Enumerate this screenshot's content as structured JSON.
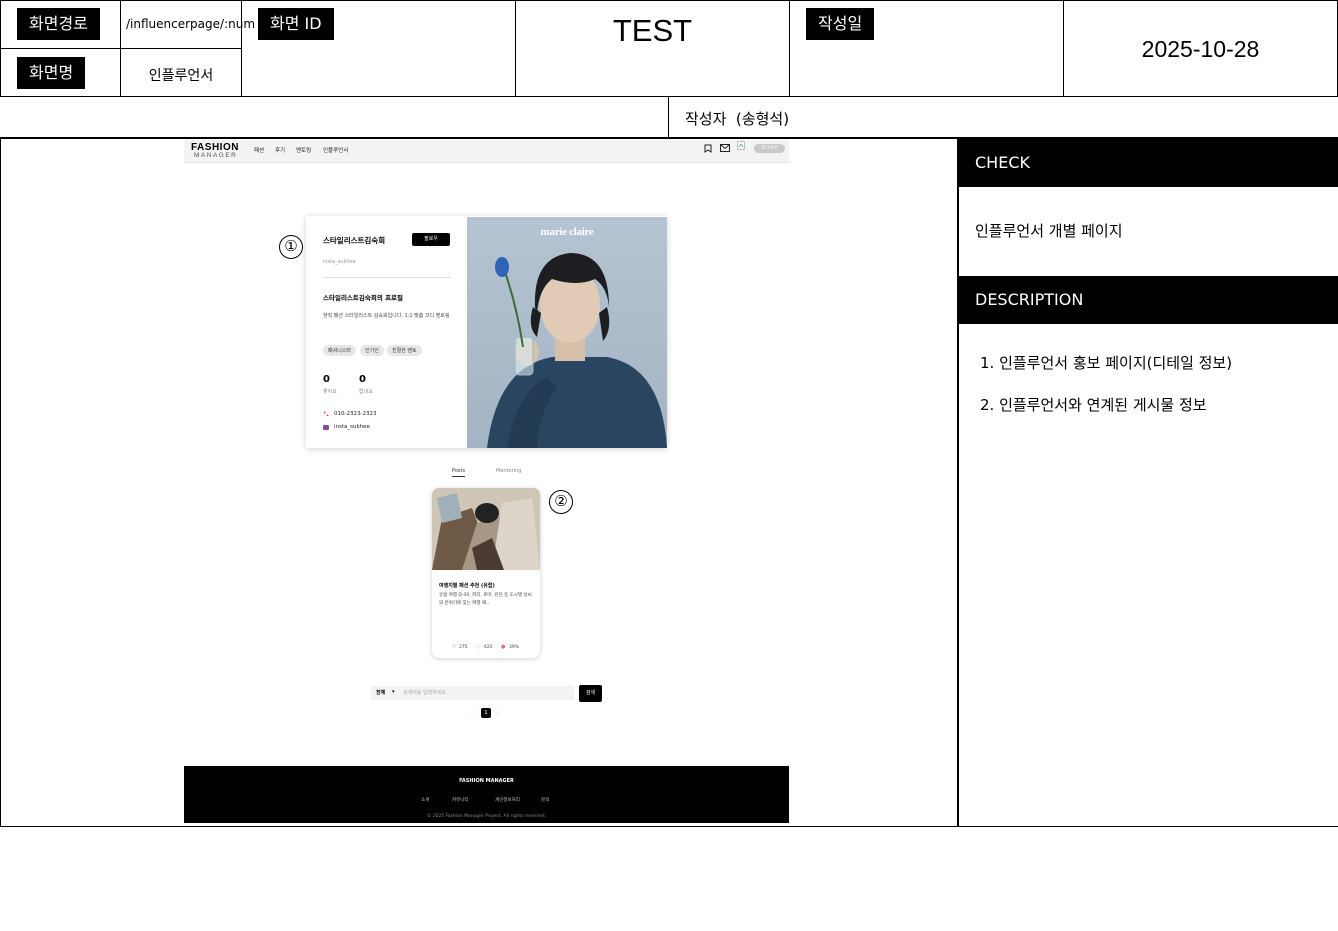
{
  "header": {
    "path_label": "화면경로",
    "path_value": "/influencerpage/:num",
    "name_label": "화면명",
    "name_value": "인플루언서",
    "id_label": "화면 ID",
    "test_value": "TEST",
    "date_label": "작성일",
    "date_value": "2025-10-28",
    "author": "작성자  (송형석)"
  },
  "site": {
    "logo_top": "FASHION",
    "logo_bottom": "MANAGER",
    "nav_items": [
      "패션",
      "후기",
      "멘토링",
      "인플루언서"
    ],
    "logout_label": "로그아웃",
    "profile": {
      "name": "스타일리스트김숙희",
      "follow_label": "팔로우",
      "handle": "insta_sukhee",
      "profile_title": "스타일리스트김숙희의 프로필",
      "description": "현직 패션 스타일리스트 김숙희입니다. 1:1 맞춤 코디 멘토링",
      "tags": [
        "패셔니스타",
        "인기인",
        "친절한 멘토"
      ],
      "likes_count": "0",
      "likes_label": "좋아요",
      "reviews_count": "0",
      "reviews_label": "랍내요",
      "phone": "010-2323-2323",
      "instagram": "insta_sukhee",
      "photo_brand": "marie claire"
    },
    "tabs": [
      "Posts",
      "Mentoring"
    ],
    "post": {
      "title": "여행지별 패션 추천 (유럽)",
      "excerpt": "유럽 여행 D-30, 파리, 로마, 런던 등 도시별 날씨와 분위기에 맞는 여행 패...",
      "likes": "275",
      "views": "425",
      "rate": "39%"
    },
    "search": {
      "select_value": "전체",
      "placeholder": "검색어를 입력하세요",
      "button_label": "검색"
    },
    "pagination": [
      "1"
    ],
    "footer": {
      "brand": "FASHION MANAGER",
      "links": [
        "소개",
        "커뮤니티",
        "개인정보처리",
        "문의"
      ],
      "copyright": "© 2025 Fashion Manager Project. All rights reserved."
    }
  },
  "markers": [
    "①",
    "②"
  ],
  "sidebar": {
    "check_title": "CHECK",
    "check_text": "인플루언서 개별 페이지",
    "desc_title": "DESCRIPTION",
    "desc_items": [
      "1. 인플루언서 홍보 페이지(디테일 정보)",
      "2. 인플루언서와 연계된 게시물 정보"
    ]
  }
}
